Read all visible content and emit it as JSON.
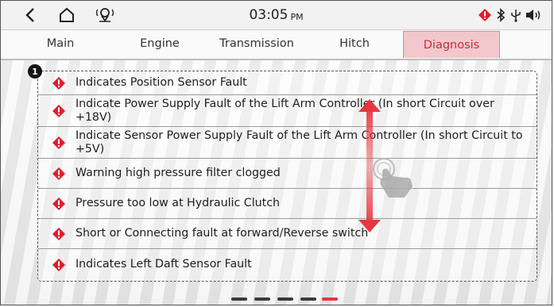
{
  "statusbar": {
    "time": "03:05",
    "ampm": "PM",
    "left_icons": [
      "back-chevron-icon",
      "home-icon",
      "gps-signal-icon"
    ],
    "right_icons": [
      "warning-diamond-icon",
      "bluetooth-icon",
      "usb-icon",
      "volume-icon"
    ]
  },
  "tabs": [
    {
      "label": "Main",
      "active": false
    },
    {
      "label": "Engine",
      "active": false
    },
    {
      "label": "Transmission",
      "active": false
    },
    {
      "label": "Hitch",
      "active": false
    },
    {
      "label": "Diagnosis",
      "active": true
    }
  ],
  "callout_number": "1",
  "faults": [
    {
      "text": "Indicates Position Sensor Fault"
    },
    {
      "text": "Indicate Power Supply Fault of the Lift Arm Controller (In short Circuit over +18V)"
    },
    {
      "text": "Indicate Sensor Power Supply Fault of the Lift Arm Controller (In short Circuit to +5V)"
    },
    {
      "text": "Warning high pressure filter clogged"
    },
    {
      "text": "Pressure too low at Hydraulic Clutch"
    },
    {
      "text": "Short or Connecting fault at forward/Reverse switch"
    },
    {
      "text": "Indicates Left Daft Sensor Fault"
    }
  ],
  "page_indicator": {
    "total": 5,
    "current": 5
  },
  "colors": {
    "accent": "#d0283c",
    "warning": "#e11d2b",
    "tab_active_bg": "#f2c8cc"
  },
  "overlay_icons": [
    "vertical-scroll-arrow-icon",
    "swipe-hand-icon"
  ]
}
